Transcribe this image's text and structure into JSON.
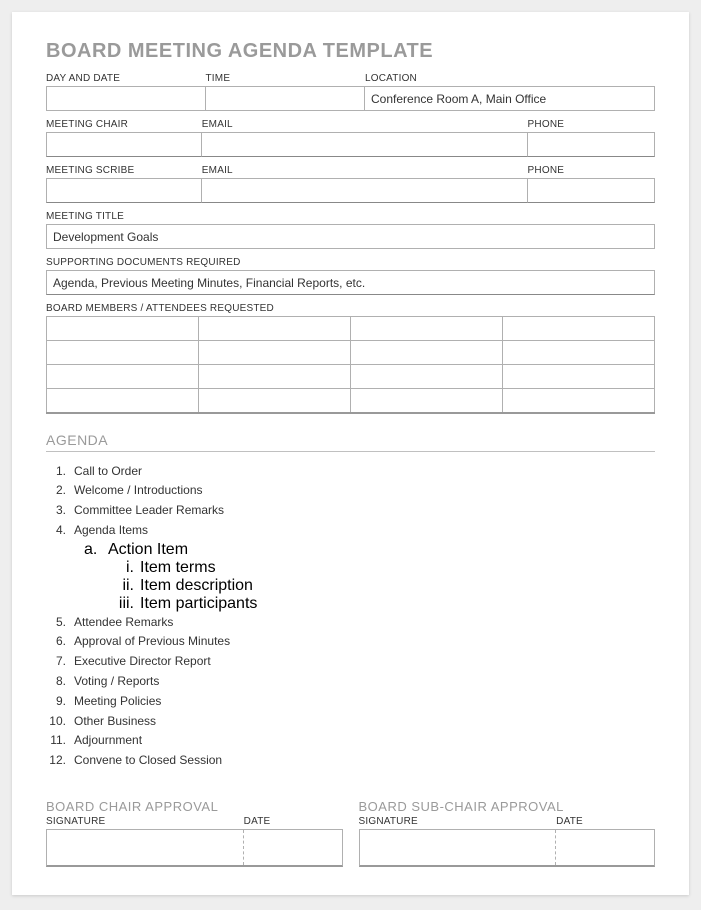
{
  "title": "BOARD MEETING AGENDA TEMPLATE",
  "row1": {
    "day_date_label": "DAY AND DATE",
    "day_date_value": "",
    "time_label": "TIME",
    "time_value": "",
    "location_label": "LOCATION",
    "location_value": "Conference Room A, Main Office"
  },
  "chair": {
    "name_label": "MEETING CHAIR",
    "name_value": "",
    "email_label": "EMAIL",
    "email_value": "",
    "phone_label": "PHONE",
    "phone_value": ""
  },
  "scribe": {
    "name_label": "MEETING SCRIBE",
    "name_value": "",
    "email_label": "EMAIL",
    "email_value": "",
    "phone_label": "PHONE",
    "phone_value": ""
  },
  "meeting_title": {
    "label": "MEETING TITLE",
    "value": "Development Goals"
  },
  "supporting_docs": {
    "label": "SUPPORTING DOCUMENTS REQUIRED",
    "value": "Agenda, Previous Meeting Minutes, Financial Reports, etc."
  },
  "attendees": {
    "label": "BOARD MEMBERS / ATTENDEES REQUESTED"
  },
  "agenda_heading": "AGENDA",
  "agenda_items": {
    "i1": "Call to Order",
    "i2": "Welcome / Introductions",
    "i3": "Committee Leader Remarks",
    "i4": "Agenda Items",
    "i4a": "Action Item",
    "i4a1": "Item terms",
    "i4a2": "Item description",
    "i4a3": "Item participants",
    "i5": "Attendee Remarks",
    "i6": "Approval of Previous Minutes",
    "i7": "Executive Director Report",
    "i8": "Voting / Reports",
    "i9": "Meeting Policies",
    "i10": "Other Business",
    "i11": "Adjournment",
    "i12": "Convene to Closed Session"
  },
  "approval": {
    "chair_title": "BOARD CHAIR APPROVAL",
    "subchair_title": "BOARD SUB-CHAIR APPROVAL",
    "signature_label": "SIGNATURE",
    "date_label": "DATE"
  }
}
